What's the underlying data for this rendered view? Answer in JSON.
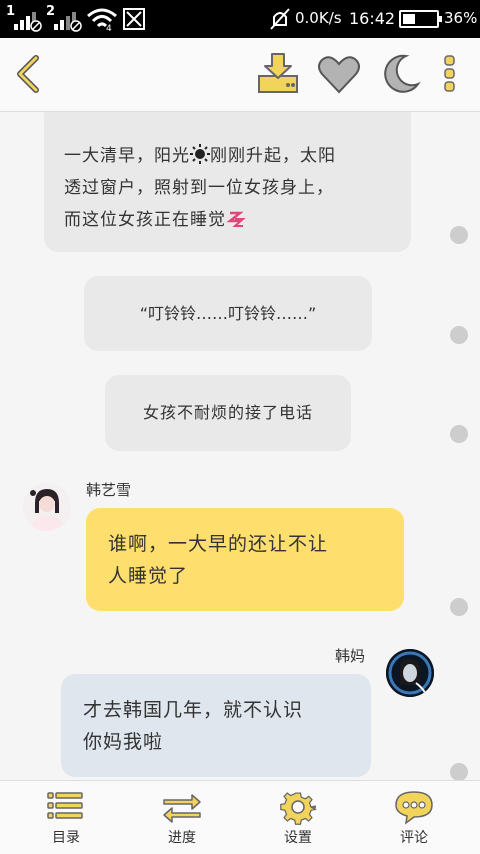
{
  "status_bar": {
    "sim1": "1",
    "sim2": "2",
    "network_speed": "0.0K/s",
    "time": "16:42",
    "battery_percent": "36%",
    "battery_level": 0.36
  },
  "toolbar": {
    "back_icon": "back-chevron",
    "download_icon": "download",
    "like_icon": "heart",
    "night_mode_icon": "moon",
    "more_icon": "vertical-dots",
    "accent_color": "#f2d45c"
  },
  "story": {
    "narration_1": "一大清早，阳光☀刚刚升起，太阳透过窗户，照射到一位女孩身上，而这位女孩正在睡觉",
    "narration_1_lines": [
      "一大清早，阳光",
      "刚刚升起，太阳",
      "透过窗户，照射到一位女孩身上，",
      "而这位女孩正在睡觉"
    ],
    "narration_2": "“叮铃铃……叮铃铃……”",
    "narration_3": "女孩不耐烦的接了电话",
    "message_1": {
      "speaker": "韩艺雪",
      "lines": [
        "谁啊，一大早的还让不让",
        "人睡觉了"
      ],
      "bubble_color": "#fedf6e"
    },
    "message_2": {
      "speaker": "韩妈",
      "lines": [
        "才去韩国几年，就不认识",
        "你妈我啦"
      ],
      "bubble_color": "#dfe6ee"
    }
  },
  "bottom_nav": {
    "items": [
      {
        "label": "目录",
        "icon": "list-icon"
      },
      {
        "label": "进度",
        "icon": "progress-arrows-icon"
      },
      {
        "label": "设置",
        "icon": "gear-icon"
      },
      {
        "label": "评论",
        "icon": "comment-icon"
      }
    ]
  }
}
